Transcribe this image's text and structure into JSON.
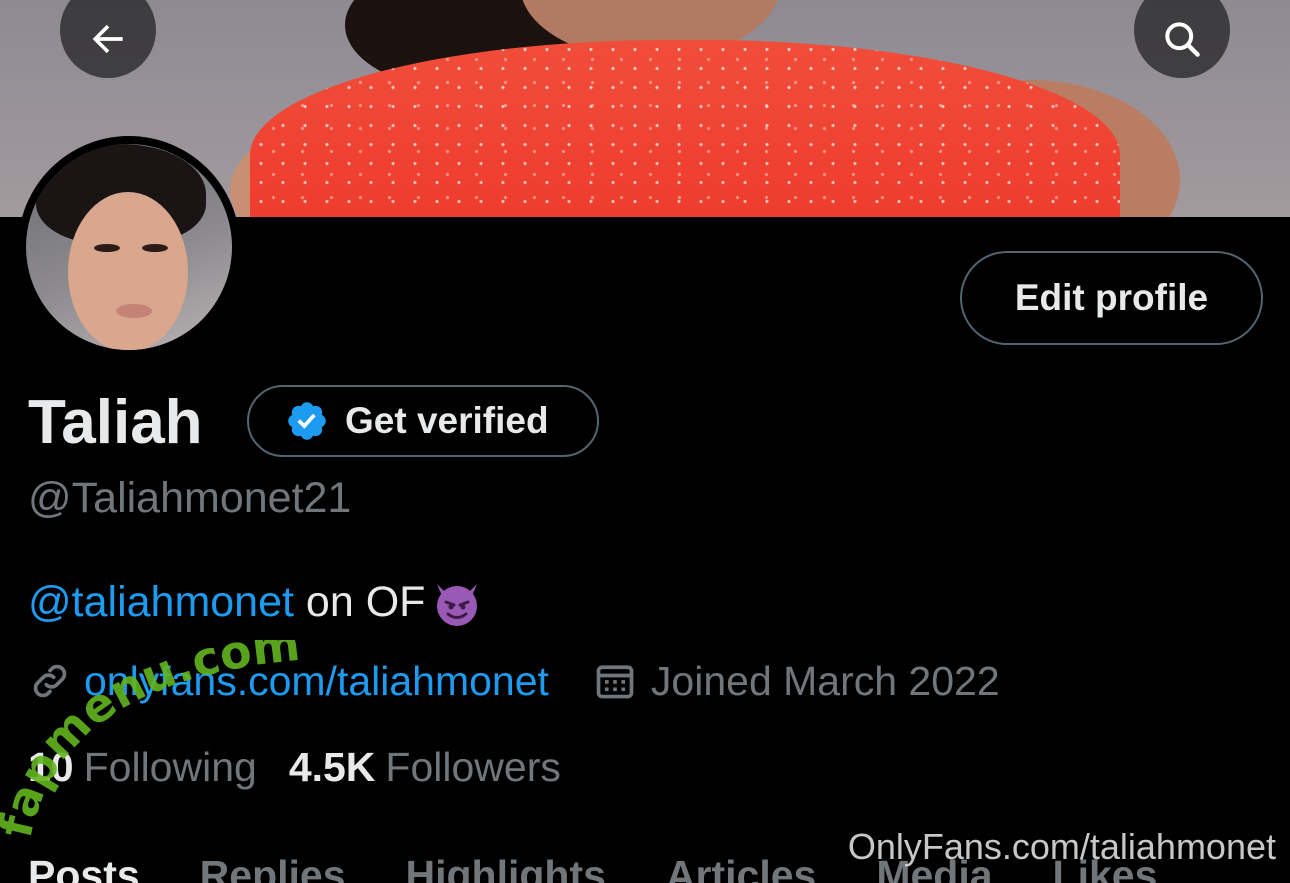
{
  "header": {
    "back_icon": "arrow-left-icon",
    "search_icon": "search-icon"
  },
  "profile": {
    "display_name": "Taliah",
    "handle": "@Taliahmonet21",
    "edit_button_label": "Edit profile",
    "get_verified_label": "Get verified",
    "verified_badge_icon": "verified-badge-icon",
    "bio": {
      "mention": "@taliahmonet",
      "text": " on OF",
      "emoji": "smiling-imp-emoji"
    },
    "website": "onlyfans.com/taliahmonet",
    "joined": "Joined March 2022"
  },
  "stats": {
    "following_count": "10",
    "following_label": "Following",
    "followers_count": "4.5K",
    "followers_label": "Followers"
  },
  "tabs": [
    "Posts",
    "Replies",
    "Highlights",
    "Articles",
    "Media",
    "Likes"
  ],
  "watermarks": {
    "site_logo_text": "fapmenu.com",
    "bottom_right": "OnlyFans.com/taliahmonet"
  },
  "colors": {
    "background": "#000000",
    "accent": "#1d9bf0",
    "muted_text": "#71767b",
    "border": "#536471",
    "logo_green": "#63b51f"
  }
}
